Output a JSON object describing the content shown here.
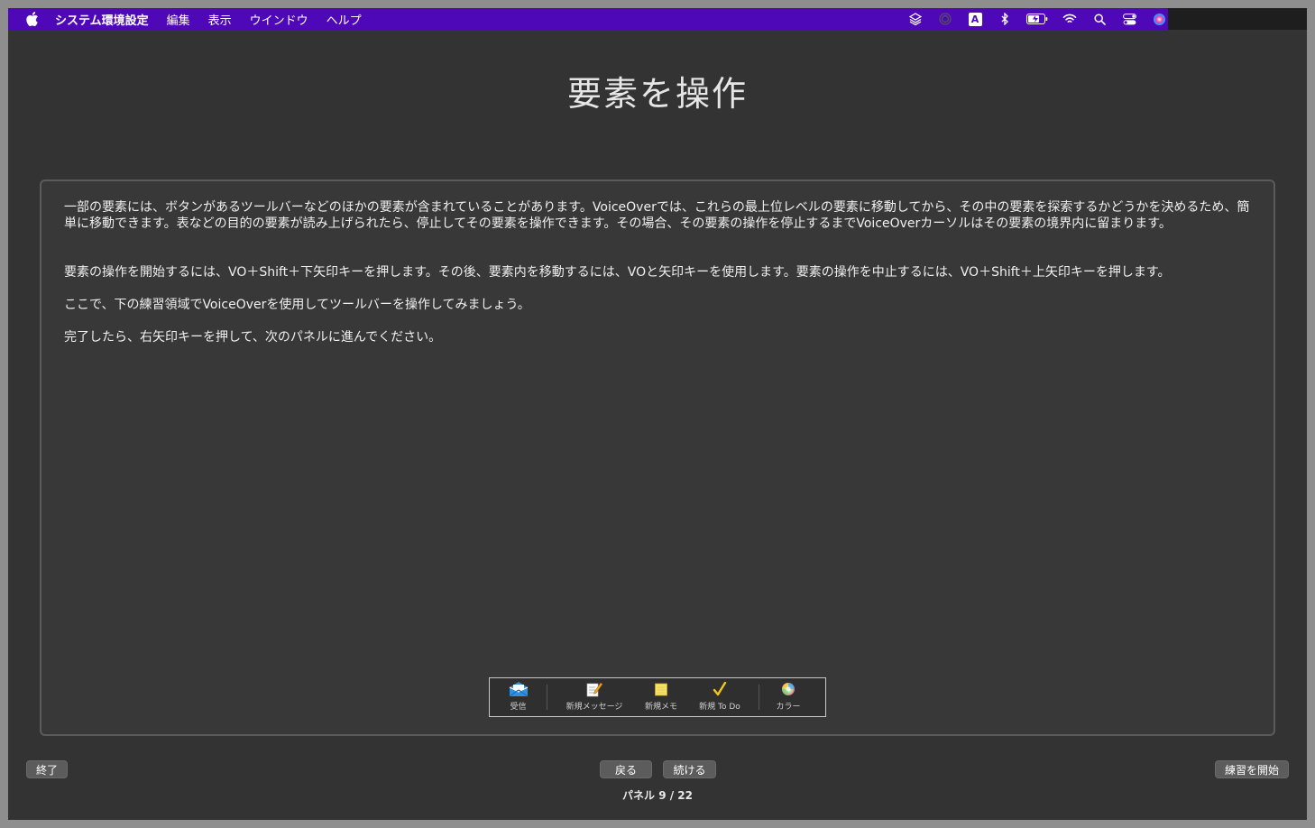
{
  "menubar": {
    "app_name": "システム環境設定",
    "items": [
      "編集",
      "表示",
      "ウインドウ",
      "ヘルプ"
    ],
    "status_icons": [
      "layers-icon",
      "fingerprint-icon",
      "input-source-icon",
      "bluetooth-icon",
      "battery-icon",
      "wifi-icon",
      "spotlight-search-icon",
      "control-center-icon",
      "siri-icon"
    ],
    "input_source_label": "A",
    "accent_color": "#4f08b8"
  },
  "page": {
    "title": "要素を操作",
    "paragraphs": [
      "一部の要素には、ボタンがあるツールバーなどのほかの要素が含まれていることがあります。VoiceOverでは、これらの最上位レベルの要素に移動してから、その中の要素を探索するかどうかを決めるため、簡単に移動できます。表などの目的の要素が読み上げられたら、停止してその要素を操作できます。その場合、その要素の操作を停止するまでVoiceOverカーソルはその要素の境界内に留まります。",
      "要素の操作を開始するには、VO＋Shift＋下矢印キーを押します。その後、要素内を移動するには、VOと矢印キーを使用します。要素の操作を中止するには、VO＋Shift＋上矢印キーを押します。",
      "ここで、下の練習領域でVoiceOverを使用してツールバーを操作してみましょう。",
      "完了したら、右矢印キーを押して、次のパネルに進んでください。"
    ]
  },
  "toolbar": {
    "items": [
      {
        "label": "受信",
        "icon": "inbox-icon"
      },
      {
        "label": "新規メッセージ",
        "icon": "compose-icon"
      },
      {
        "label": "新規メモ",
        "icon": "note-icon"
      },
      {
        "label": "新規 To Do",
        "icon": "checkmark-icon"
      },
      {
        "label": "カラー",
        "icon": "color-wheel-icon"
      }
    ]
  },
  "footer": {
    "quit_label": "終了",
    "back_label": "戻る",
    "continue_label": "続ける",
    "practice_label": "練習を開始",
    "panel_indicator": "パネル 9 / 22"
  }
}
